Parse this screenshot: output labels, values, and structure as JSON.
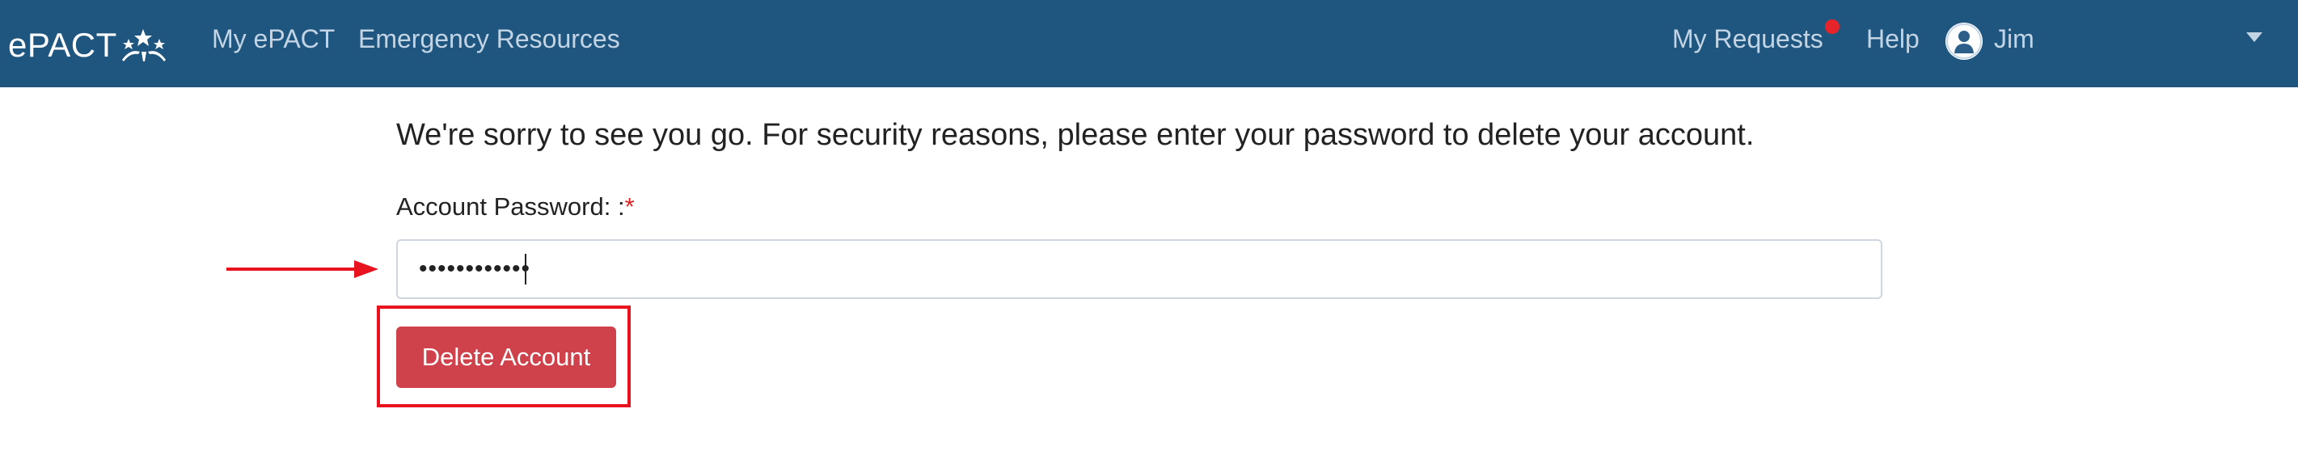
{
  "navbar": {
    "brand": "ePACT",
    "links": {
      "my_epact": "My ePACT",
      "emergency_resources": "Emergency Resources",
      "my_requests": "My Requests",
      "help": "Help"
    },
    "user_name": "Jim",
    "badge_color": "#e8242b",
    "background_color": "#1f5680"
  },
  "main": {
    "message": "We're sorry to see you go. For security reasons, please enter your password to delete your account.",
    "password_label": "Account Password: :",
    "required_marker": "*",
    "password_value": "••••••••••••",
    "delete_button_label": "Delete Account",
    "delete_button_color": "#d0424b",
    "annotation_color": "#e8131f"
  }
}
